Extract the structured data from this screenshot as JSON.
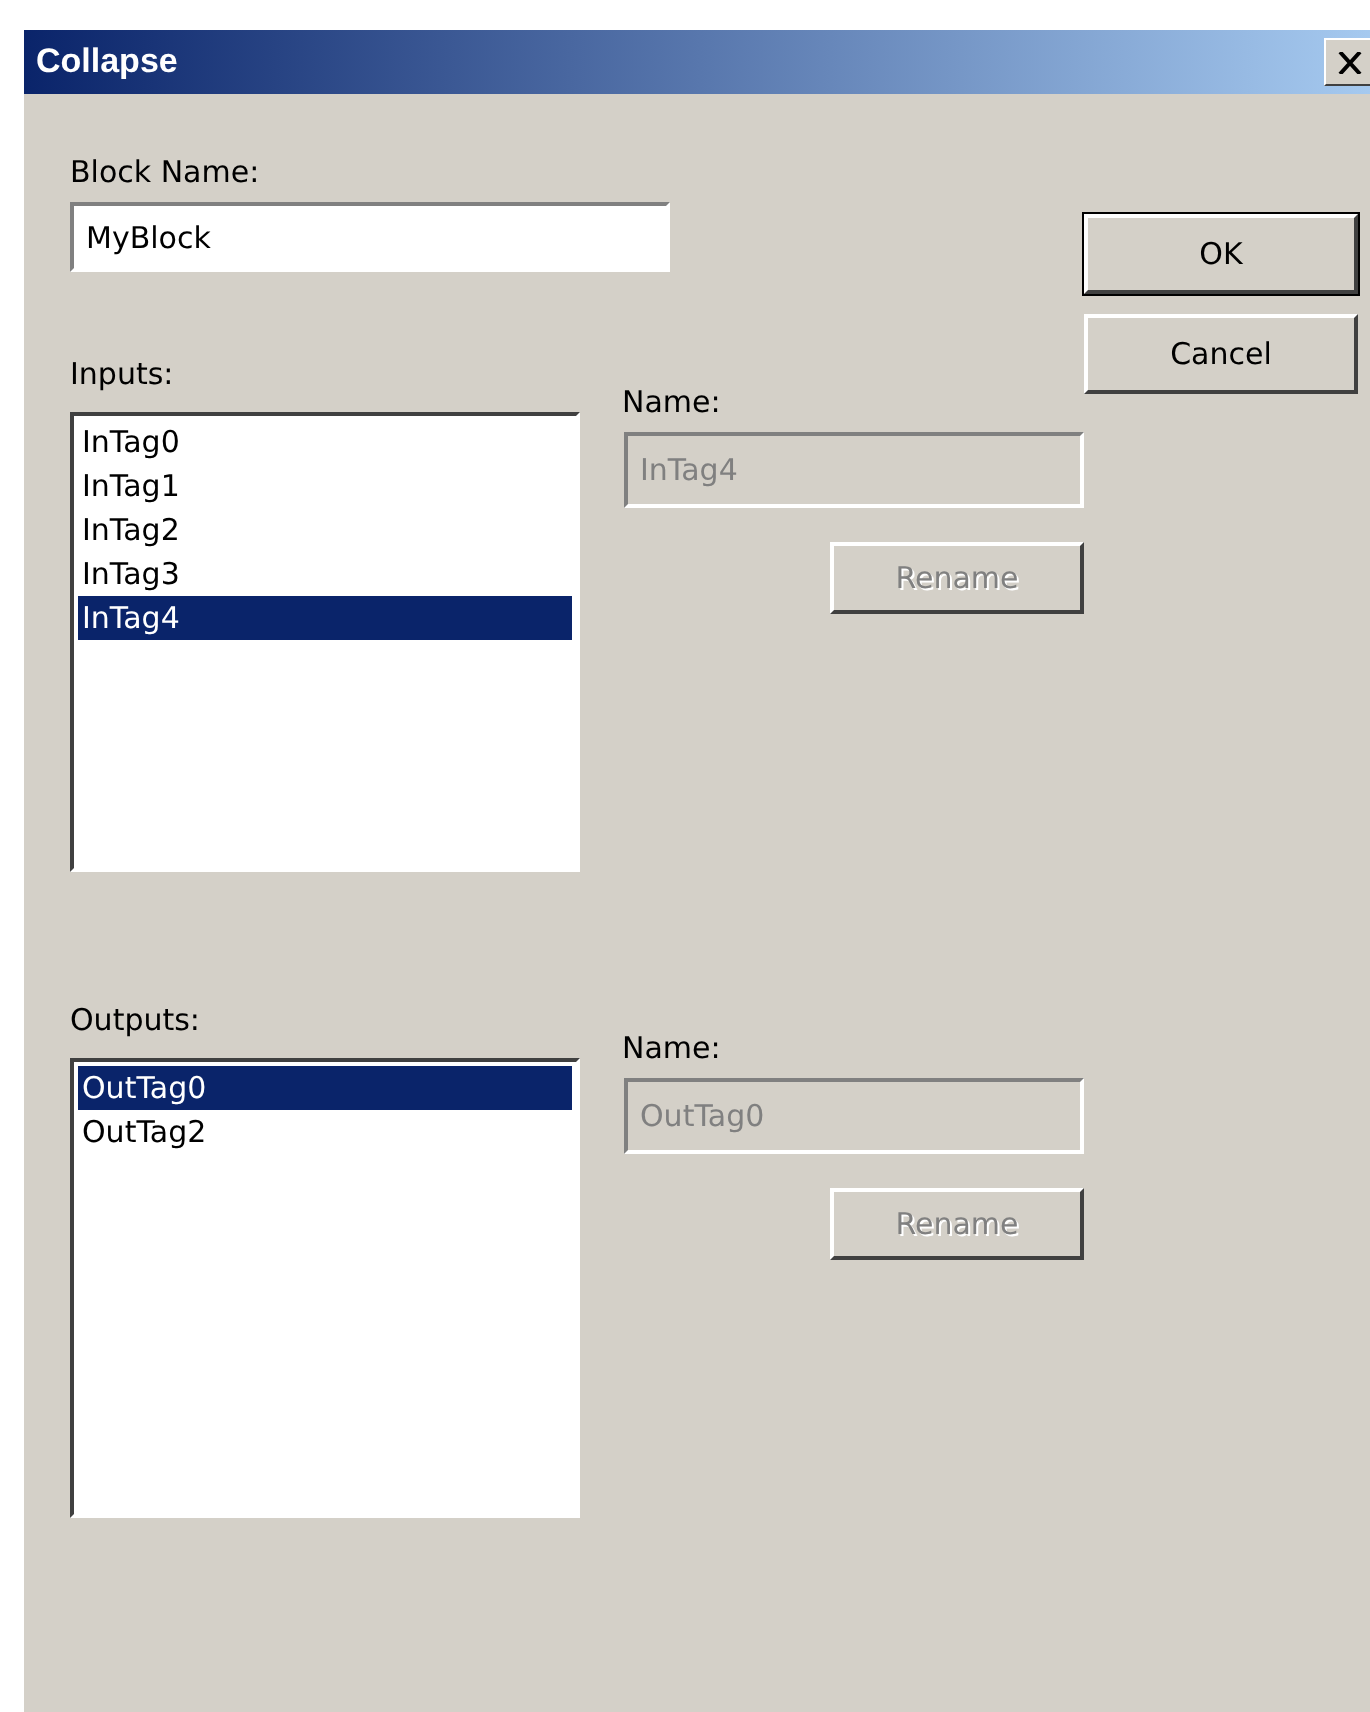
{
  "window": {
    "title": "Collapse"
  },
  "block_name": {
    "label": "Block Name:",
    "value": "MyBlock"
  },
  "buttons": [
    {
      "label": "OK",
      "kind": "default"
    },
    {
      "label": "Cancel",
      "kind": "normal"
    }
  ],
  "groups": [
    {
      "label": "Inputs:",
      "items": [
        {
          "text": "InTag0",
          "selected": false
        },
        {
          "text": "InTag1",
          "selected": false
        },
        {
          "text": "InTag2",
          "selected": false
        },
        {
          "text": "InTag3",
          "selected": false
        },
        {
          "text": "InTag4",
          "selected": true
        }
      ],
      "name_label": "Name:",
      "name_value": "InTag4",
      "name_disabled": true,
      "rename": {
        "label": "Rename",
        "disabled": true
      }
    },
    {
      "label": "Outputs:",
      "items": [
        {
          "text": "OutTag0",
          "selected": true
        },
        {
          "text": "OutTag2",
          "selected": false
        }
      ],
      "name_label": "Name:",
      "name_value": "OutTag0",
      "name_disabled": true,
      "rename": {
        "label": "Rename",
        "disabled": true
      }
    }
  ]
}
